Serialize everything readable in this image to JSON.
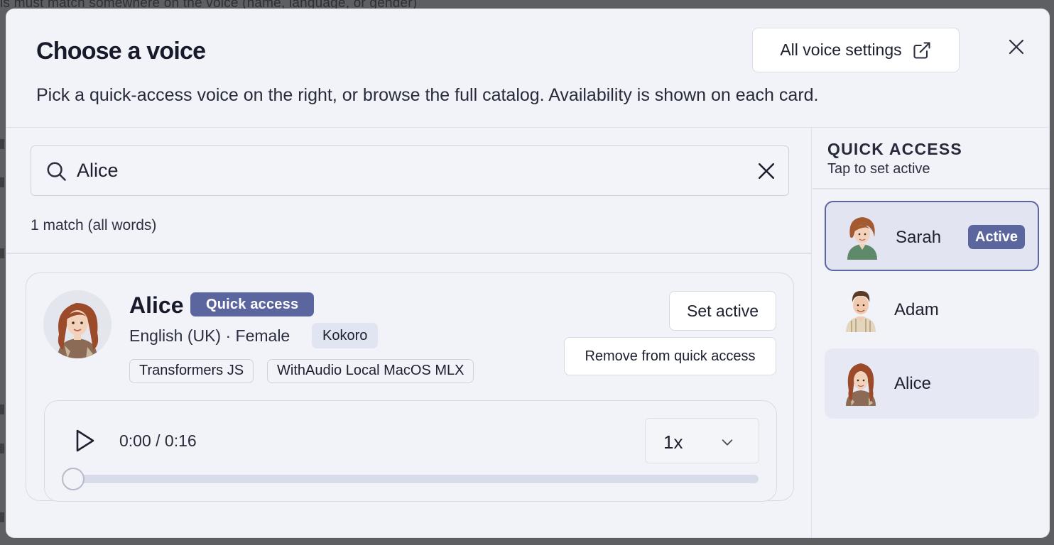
{
  "backdrop": {
    "partial_text": "ls must match somewhere on the voice (name, language, or gender)"
  },
  "dialog": {
    "title": "Choose a voice",
    "subtitle": "Pick a quick-access voice on the right, or browse the full catalog. Availability is shown on each card.",
    "settings_button": "All voice settings",
    "settings_icon": "external-link-icon",
    "close_icon": "close-icon"
  },
  "search": {
    "value": "Alice",
    "icon": "search-icon",
    "clear_icon": "clear-icon",
    "match_count": "1 match (all words)"
  },
  "result": {
    "name": "Alice",
    "badge": "Quick access",
    "meta": "English (UK) · Female",
    "engine": "Kokoro",
    "tags": [
      "Transformers JS",
      "WithAudio Local MacOS MLX"
    ],
    "set_active_label": "Set active",
    "remove_label": "Remove from quick access",
    "player": {
      "time": "0:00 / 0:16",
      "speed": "1x",
      "progress": 0
    }
  },
  "quick_access": {
    "title": "QUICK ACCESS",
    "subtitle": "Tap to set active",
    "items": [
      {
        "name": "Sarah",
        "badge": "Active",
        "state": "active"
      },
      {
        "name": "Adam",
        "badge": "",
        "state": "normal"
      },
      {
        "name": "Alice",
        "badge": "",
        "state": "hover"
      }
    ]
  },
  "colors": {
    "accent": "#5b669f",
    "panel": "#f2f3f8",
    "chip": "#e1e4f1"
  }
}
